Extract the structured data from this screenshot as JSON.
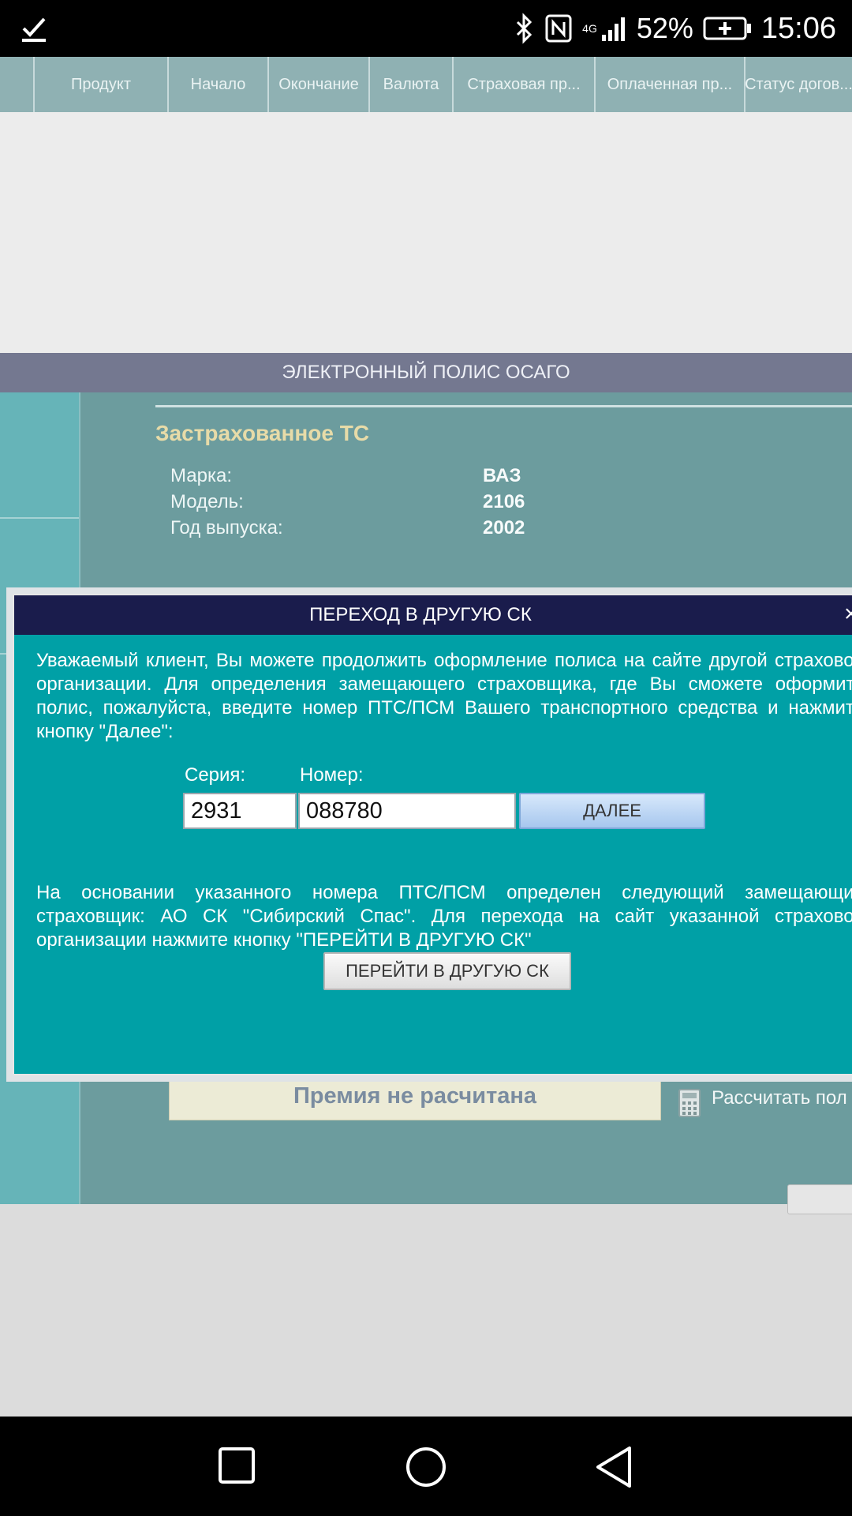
{
  "status_bar": {
    "battery_percent": "52%",
    "time": "15:06",
    "network": "4G",
    "icons": [
      "download-done-icon",
      "bluetooth-icon",
      "nfc-icon",
      "signal-icon",
      "battery-charging-icon"
    ]
  },
  "table_header": {
    "columns": [
      "Продукт",
      "Начало",
      "Окончание",
      "Валюта",
      "Страховая пр...",
      "Оплаченная пр...",
      "Статус догов..."
    ]
  },
  "section": {
    "title": "ЭЛЕКТРОННЫЙ ПОЛИС ОСАГО"
  },
  "vehicle": {
    "title": "Застрахованное ТС",
    "make_label": "Марка:",
    "make_value": "ВАЗ",
    "model_label": "Модель:",
    "model_value": "2106",
    "year_label": "Год выпуска:",
    "year_value": "2002"
  },
  "premium": {
    "text": "Премия не расчитана",
    "calc_link": "Рассчитать пол"
  },
  "dialog": {
    "title": "ПЕРЕХОД В ДРУГУЮ СК",
    "close": "×",
    "intro": "Уважаемый клиент, Вы можете продолжить оформление полиса на сайте другой страховой организации. Для определения замещающего страховщика, где Вы сможете оформить полис, пожалуйста, введите номер ПТС/ПСМ Вашего транспортного средства и нажмите кнопку \"Далее\":",
    "series_label": "Серия:",
    "series_value": "2931",
    "number_label": "Номер:",
    "number_value": "088780",
    "next_button": "ДАЛЕЕ",
    "result": "На основании указанного номера ПТС/ПСМ определен следующий замещающий страховщик: АО СК \"Сибирский Спас\". Для перехода на сайт указанной страховой организации нажмите кнопку \"ПЕРЕЙТИ В ДРУГУЮ СК\"",
    "go_button": "ПЕРЕЙТИ В ДРУГУЮ СК"
  },
  "nav_bar": {
    "icons": [
      "recents-square-icon",
      "home-circle-icon",
      "back-triangle-icon"
    ]
  }
}
